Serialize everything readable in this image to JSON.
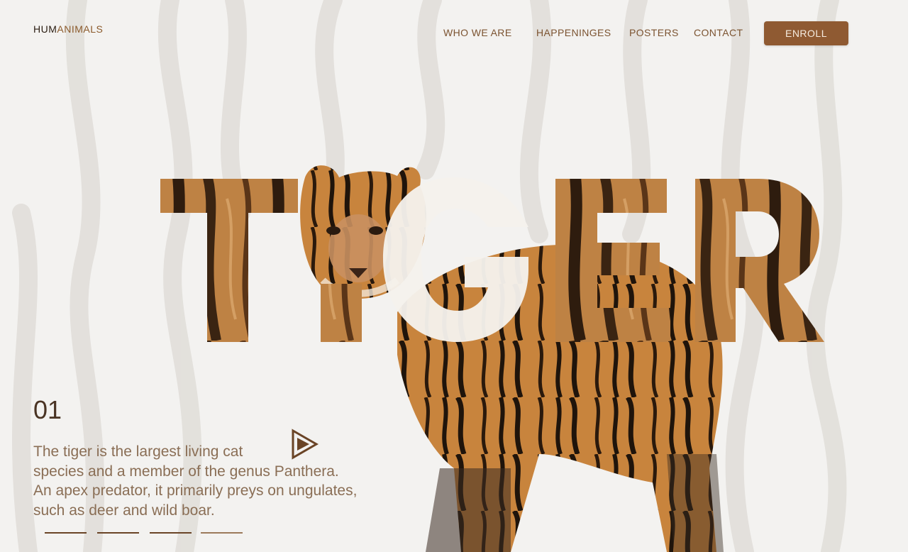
{
  "brand": {
    "part1": "HUM",
    "part2": "ANIMALS"
  },
  "nav": {
    "items": [
      {
        "label": "WHO WE ARE"
      },
      {
        "label": "HAPPENINGES"
      },
      {
        "label": "POSTERS"
      },
      {
        "label": "CONTACT"
      }
    ],
    "cta_label": "ENROLL"
  },
  "hero": {
    "title": "TIGER",
    "slide_number": "01",
    "description": [
      "The tiger is the largest living cat",
      "species and a member of the genus Panthera.",
      "An apex predator, it primarily preys on ungulates,",
      "such as deer and wild boar."
    ],
    "pager": {
      "total": 4,
      "active": 1
    }
  },
  "colors": {
    "accent": "#8f5a32",
    "nav_text": "#7b5330",
    "background": "#f3f2f0",
    "tiger_orange": "#c8843d"
  },
  "icons": {
    "play": "play-triangle-icon"
  }
}
